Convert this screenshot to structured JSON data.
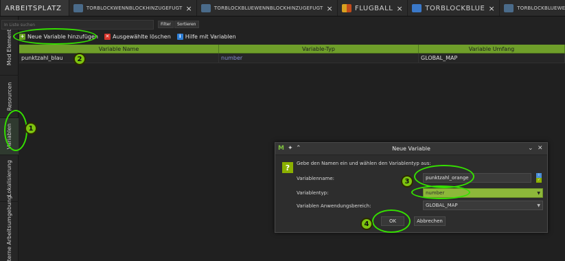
{
  "tabs": [
    {
      "label": "ARBEITSPLATZ",
      "icon": "",
      "closable": false
    },
    {
      "label": "TORBLOCKWENNBLOCKHINZUGEFUGT",
      "icon": "event-icon",
      "closable": true
    },
    {
      "label": "TORBLOCKBLUEWENNBLOCKHINZUGEFUGT",
      "icon": "event-icon",
      "closable": true
    },
    {
      "label": "FLUGBALL",
      "icon": "entity-icon",
      "closable": true
    },
    {
      "label": "TORBLOCKBLUE",
      "icon": "block-icon",
      "closable": true
    },
    {
      "label": "TORBLOCKBLUEWENNENTITATIMBLOCK",
      "icon": "event-icon",
      "closable": false
    }
  ],
  "sidebar": {
    "items": [
      {
        "label": "Mod Elemente"
      },
      {
        "label": "Resourcen"
      },
      {
        "label": "Variablen"
      },
      {
        "label": "Lokalisierung"
      },
      {
        "label": "Externe Arbeitsumgebung"
      }
    ]
  },
  "search": {
    "placeholder": "In Liste suchen",
    "filter_label": "Filter",
    "sort_label": "Sortieren"
  },
  "toolbar": {
    "add_label": "Neue Variable hinzufügen",
    "delete_label": "Ausgewählte löschen",
    "help_label": "Hilfe mit Variablen"
  },
  "table": {
    "headers": [
      "Variable Name",
      "Variable-Typ",
      "Variable Umfang"
    ],
    "rows": [
      {
        "name": "punktzahl_blau",
        "type": "number",
        "scope": "GLOBAL_MAP"
      }
    ]
  },
  "dialog": {
    "title": "Neue Variable",
    "prompt": "Gebe den Namen ein und wählen den Variablentyp aus:",
    "name_label": "Variablenname:",
    "name_value": "punktzahl_orange",
    "type_label": "Variablentyp:",
    "type_value": "number",
    "scope_label": "Variablen Anwendungsbereich:",
    "scope_value": "GLOBAL_MAP",
    "ok_label": "OK",
    "cancel_label": "Abbrechen"
  },
  "annotations": [
    "1",
    "2",
    "3",
    "4"
  ],
  "colors": {
    "accent_green": "#6f9f2a",
    "highlight": "#35e000",
    "type_text": "#8790d8"
  }
}
